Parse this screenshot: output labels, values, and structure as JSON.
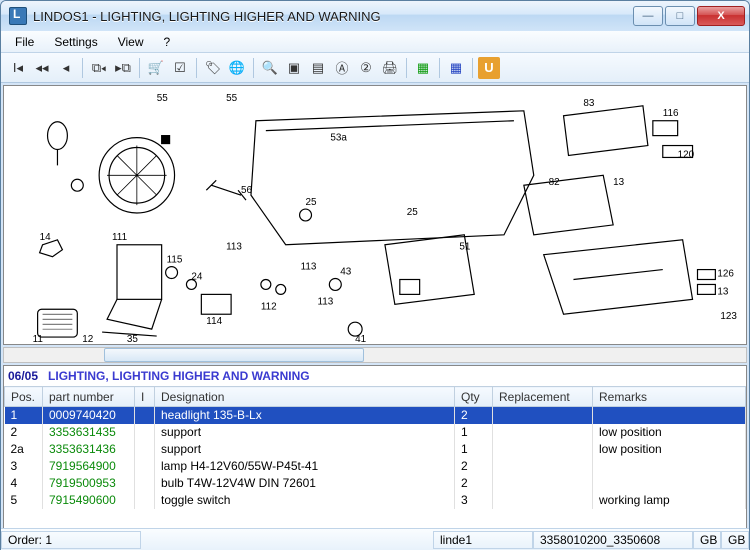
{
  "window": {
    "title": "LINDOS1 - LIGHTING, LIGHTING HIGHER AND WARNING"
  },
  "menu": {
    "file": "File",
    "settings": "Settings",
    "view": "View",
    "help": "?"
  },
  "diagram": {
    "labels": [
      "55",
      "55",
      "53a",
      "83",
      "116",
      "120",
      "56",
      "82",
      "13",
      "14",
      "111",
      "113",
      "25",
      "51",
      "113",
      "115",
      "24",
      "113",
      "43",
      "114",
      "112",
      "126",
      "13",
      "25",
      "11",
      "12",
      "35",
      "41",
      "123"
    ]
  },
  "list": {
    "code": "06/05",
    "title": "LIGHTING, LIGHTING HIGHER AND WARNING",
    "headers": {
      "pos": "Pos.",
      "pn": "part number",
      "i": "I",
      "des": "Designation",
      "qty": "Qty",
      "rep": "Replacement",
      "rem": "Remarks"
    },
    "rows": [
      {
        "pos": "1",
        "pn": "0009740420",
        "pn_style": "blue",
        "i": "",
        "des": "headlight 135-B-Lx",
        "qty": "2",
        "rep": "",
        "rem": "",
        "selected": true
      },
      {
        "pos": "2",
        "pn": "3353631435",
        "pn_style": "green",
        "i": "",
        "des": "support",
        "qty": "1",
        "rep": "",
        "rem": "low position"
      },
      {
        "pos": "2a",
        "pn": "3353631436",
        "pn_style": "green",
        "i": "",
        "des": "support",
        "qty": "1",
        "rep": "",
        "rem": "low position"
      },
      {
        "pos": "3",
        "pn": "7919564900",
        "pn_style": "green",
        "i": "",
        "des": "lamp H4-12V60/55W-P45t-41",
        "qty": "2",
        "rep": "",
        "rem": ""
      },
      {
        "pos": "4",
        "pn": "7919500953",
        "pn_style": "green",
        "i": "",
        "des": "bulb T4W-12V4W  DIN 72601",
        "qty": "2",
        "rep": "",
        "rem": ""
      },
      {
        "pos": "5",
        "pn": "7915490600",
        "pn_style": "green",
        "i": "",
        "des": "toggle switch",
        "qty": "3",
        "rep": "",
        "rem": "working lamp"
      }
    ]
  },
  "status": {
    "order_label": "Order:",
    "order_val": "1",
    "user": "linde1",
    "doc": "3358010200_3350608",
    "lang1": "GB",
    "lang2": "GB"
  }
}
